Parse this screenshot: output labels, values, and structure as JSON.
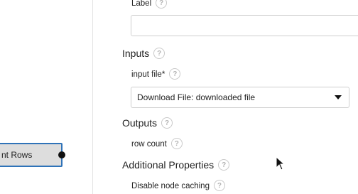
{
  "node": {
    "label": "nt Rows"
  },
  "panel": {
    "label_field": {
      "label": "Label",
      "value": ""
    },
    "inputs": {
      "title": "Inputs",
      "input_file": {
        "label": "input file*",
        "selected": "Download File: downloaded file"
      }
    },
    "outputs": {
      "title": "Outputs",
      "row_count": {
        "label": "row count"
      }
    },
    "additional": {
      "title": "Additional Properties",
      "disable_caching": {
        "label": "Disable node caching"
      }
    },
    "help_glyph": "?"
  }
}
